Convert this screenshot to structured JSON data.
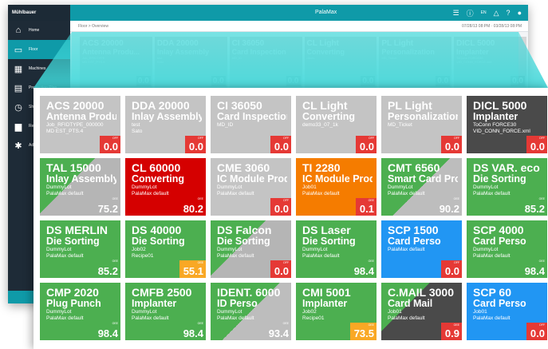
{
  "app": {
    "brand": "Mühlbauer",
    "title": "PalaMax",
    "lang": "EN",
    "breadcrumb": "Floor  >  Overview",
    "datetime": "07/28/13 08:PM · 03/28/13 08:PM"
  },
  "sidebar": {
    "items": [
      {
        "label": "Home",
        "icon": "home-icon",
        "glyph": "⌂"
      },
      {
        "label": "Floor",
        "icon": "monitor-icon",
        "glyph": "▭"
      },
      {
        "label": "Machines",
        "icon": "grid-icon",
        "glyph": "▦"
      },
      {
        "label": "Production Plan",
        "icon": "calendar-icon",
        "glyph": "▤"
      },
      {
        "label": "Shift",
        "icon": "clock-icon",
        "glyph": "◷"
      },
      {
        "label": "Reports",
        "icon": "document-icon",
        "glyph": "▆"
      },
      {
        "label": "Admin",
        "icon": "gear-icon",
        "glyph": "✱"
      }
    ]
  },
  "mini_tiles": [
    {
      "title": "ACS 20000",
      "sub": "Antenna Produ...",
      "l1": "Job_RFIDTYPE",
      "l2": "MD EST_PTS.4",
      "value": "0.0"
    },
    {
      "title": "DDA 20000",
      "sub": "Inlay Assembly",
      "l1": "test",
      "l2": "Sato",
      "value": "0.0"
    },
    {
      "title": "CI 36050",
      "sub": "Card Inspection",
      "l1": "",
      "l2": "MD_ID",
      "value": "0.0"
    },
    {
      "title": "CL Light",
      "sub": "Converting",
      "l1": "",
      "l2": "demo",
      "value": "0.0"
    },
    {
      "title": "PL Light",
      "sub": "Personalization",
      "l1": "",
      "l2": "MD_Ticket",
      "value": "0.0"
    },
    {
      "title": "DICL 5000",
      "sub": "Implanter",
      "l1": "ToConn FORCE30",
      "l2": "VID_CONN_FORCE.xml",
      "value": "0.0"
    }
  ],
  "tiles": [
    {
      "title": "ACS 20000",
      "sub": "Antenna Produ...",
      "l1": "Job_RFIDTYPE_000000",
      "l2": "MD EST_PTS.4",
      "value": "0.0",
      "tag": "OFF",
      "style": "grey",
      "val_style": "red"
    },
    {
      "title": "DDA 20000",
      "sub": "Inlay Assembly",
      "l1": "test",
      "l2": "Sato",
      "value": "0.0",
      "tag": "OFF",
      "style": "grey",
      "val_style": "red"
    },
    {
      "title": "CI 36050",
      "sub": "Card Inspection",
      "l1": "",
      "l2": "MD_ID",
      "value": "0.0",
      "tag": "OFF",
      "style": "grey",
      "val_style": "red"
    },
    {
      "title": "CL Light",
      "sub": "Converting",
      "l1": "",
      "l2": "demo33_07_1k",
      "value": "0.0",
      "tag": "OFF",
      "style": "grey",
      "val_style": "red"
    },
    {
      "title": "PL Light",
      "sub": "Personalization",
      "l1": "",
      "l2": "MD_Ticket",
      "value": "0.0",
      "tag": "OFF",
      "style": "grey",
      "val_style": "red"
    },
    {
      "title": "DICL 5000",
      "sub": "Implanter",
      "l1": "ToConn FORCE30",
      "l2": "VID_CONN_FORCE.xml",
      "value": "0.0",
      "tag": "OFF",
      "style": "dark",
      "val_style": "red"
    },
    {
      "title": "TAL 15000",
      "sub": "Inlay Assembly",
      "l1": "DummyLot",
      "l2": "PalaMax default",
      "value": "75.2",
      "tag": "OEE",
      "style": "split-green-grey",
      "val_style": "plain"
    },
    {
      "title": "CL 60000",
      "sub": "Converting",
      "l1": "DummyLot",
      "l2": "PalaMax default",
      "value": "80.2",
      "tag": "OEE",
      "style": "red",
      "val_style": "plain"
    },
    {
      "title": "CME 3060",
      "sub": "IC Module Prod...",
      "l1": "DummyLot",
      "l2": "PalaMax default",
      "value": "0.0",
      "tag": "OFF",
      "style": "grey",
      "val_style": "red"
    },
    {
      "title": "TI 2280",
      "sub": "IC Module Prod...",
      "l1": "Job01",
      "l2": "PalaMax default",
      "value": "0.1",
      "tag": "OEE",
      "style": "orange",
      "val_style": "red"
    },
    {
      "title": "CMT 6560",
      "sub": "Smart Card Pro...",
      "l1": "DummyLot",
      "l2": "PalaMax default",
      "value": "90.2",
      "tag": "OEE",
      "style": "split-green-grey2",
      "val_style": "plain"
    },
    {
      "title": "DS VAR. eco",
      "sub": "Die Sorting",
      "l1": "DummyLot",
      "l2": "PalaMax default",
      "value": "85.2",
      "tag": "OEE",
      "style": "green",
      "val_style": "plain"
    },
    {
      "title": "DS MERLIN",
      "sub": "Die Sorting",
      "l1": "DummyLot",
      "l2": "PalaMax default",
      "value": "85.2",
      "tag": "OEE",
      "style": "green",
      "val_style": "plain"
    },
    {
      "title": "DS 40000",
      "sub": "Die Sorting",
      "l1": "Job02",
      "l2": "Recipe01",
      "value": "55.1",
      "tag": "OEE",
      "style": "green",
      "val_style": "orange"
    },
    {
      "title": "DS Falcon",
      "sub": "Die Sorting",
      "l1": "DummyLot",
      "l2": "PalaMax default",
      "value": "0.0",
      "tag": "OFF",
      "style": "split-green-grey",
      "val_style": "red"
    },
    {
      "title": "DS Laser",
      "sub": "Die Sorting",
      "l1": "DummyLot",
      "l2": "PalaMax default",
      "value": "98.4",
      "tag": "OEE",
      "style": "green",
      "val_style": "plain"
    },
    {
      "title": "SCP 1500",
      "sub": "Card Perso",
      "l1": "",
      "l2": "PalaMax default",
      "value": "0.0",
      "tag": "OFF",
      "style": "blue",
      "val_style": "red"
    },
    {
      "title": "SCP 4000",
      "sub": "Card Perso",
      "l1": "DummyLot",
      "l2": "PalaMax default",
      "value": "98.4",
      "tag": "OEE",
      "style": "green",
      "val_style": "plain"
    },
    {
      "title": "CMP 2020",
      "sub": "Plug Punch",
      "l1": "DummyLot",
      "l2": "PalaMax default",
      "value": "98.4",
      "tag": "OEE",
      "style": "green",
      "val_style": "plain"
    },
    {
      "title": "CMFB 2500",
      "sub": "Implanter",
      "l1": "DummyLot",
      "l2": "PalaMax default",
      "value": "98.4",
      "tag": "OEE",
      "style": "green",
      "val_style": "plain"
    },
    {
      "title": "IDENT. 6000",
      "sub": "ID Perso",
      "l1": "DummyLot",
      "l2": "PalaMax default",
      "value": "93.4",
      "tag": "OEE",
      "style": "split-green-grey2",
      "val_style": "plain"
    },
    {
      "title": "CMI 5001",
      "sub": "Implanter",
      "l1": "Job02",
      "l2": "Recipe01",
      "value": "73.5",
      "tag": "OEE",
      "style": "green",
      "val_style": "orange"
    },
    {
      "title": "C.MAIL 3000",
      "sub": "Card Mail",
      "l1": "Job01",
      "l2": "PalaMax default",
      "value": "0.9",
      "tag": "OEE",
      "style": "split-dark-green",
      "val_style": "red"
    },
    {
      "title": "SCP 60",
      "sub": "Card Perso",
      "l1": "Job01",
      "l2": "PalaMax default",
      "value": "0.0",
      "tag": "OFF",
      "style": "blue",
      "val_style": "red"
    }
  ],
  "colors": {
    "teal": "#0f9aa8",
    "sidebar": "#1e2b37",
    "green": "#4caf50",
    "grey": "#c4c4c4",
    "red": "#d50000",
    "orange": "#f57c00",
    "blue": "#2196f3",
    "value_red": "#e53935",
    "value_orange": "#f9a825"
  }
}
